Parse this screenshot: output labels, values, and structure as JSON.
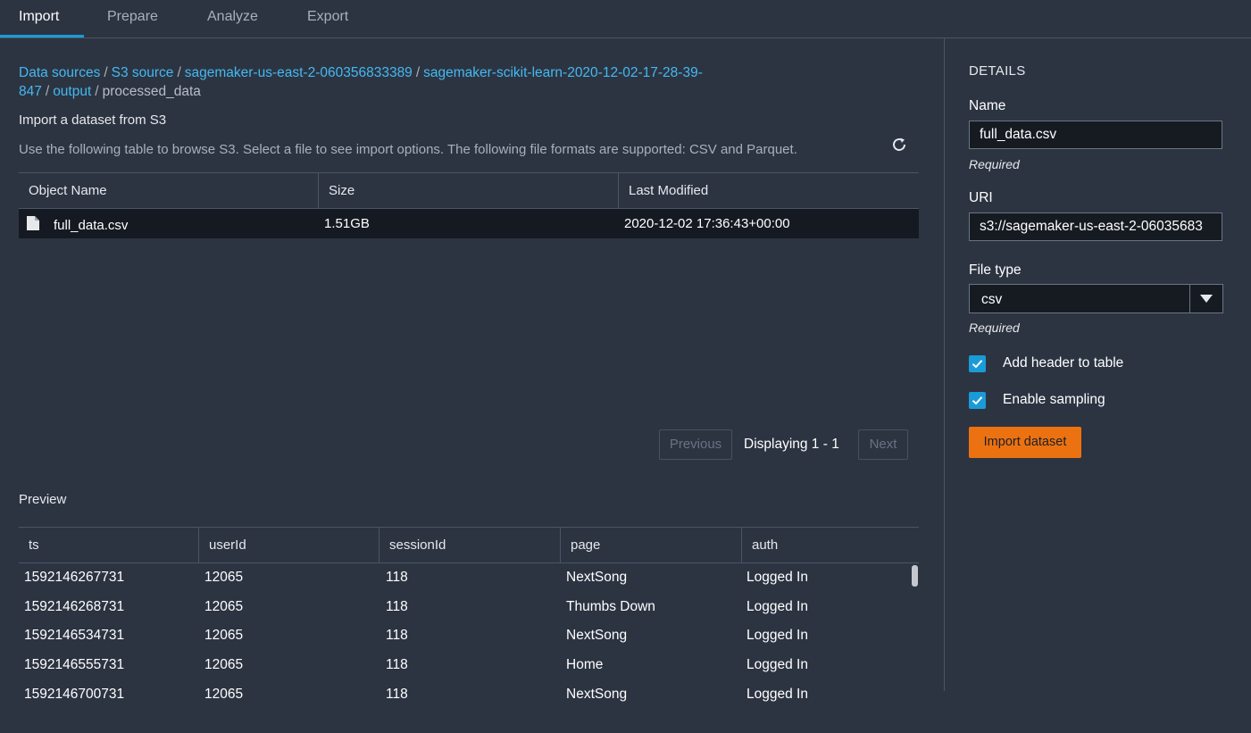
{
  "tabs": [
    {
      "label": "Import"
    },
    {
      "label": "Prepare"
    },
    {
      "label": "Analyze"
    },
    {
      "label": "Export"
    }
  ],
  "breadcrumb": {
    "items": [
      "Data sources",
      "S3 source",
      "sagemaker-us-east-2-060356833389",
      "sagemaker-scikit-learn-2020-12-02-17-28-39-",
      "847",
      "output"
    ],
    "current": "processed_data"
  },
  "import_section": {
    "title": "Import a dataset from S3",
    "description": "Use the following table to browse S3. Select a file to see import options. The following file formats are supported: CSV and Parquet."
  },
  "file_table": {
    "headers": [
      "Object Name",
      "Size",
      "Last Modified"
    ],
    "rows": [
      {
        "name": "full_data.csv",
        "size": "1.51GB",
        "modified": "2020-12-02 17:36:43+00:00"
      }
    ]
  },
  "pagination": {
    "previous": "Previous",
    "display": "Displaying 1 - 1",
    "next": "Next"
  },
  "preview": {
    "label": "Preview",
    "headers": [
      "ts",
      "userId",
      "sessionId",
      "page",
      "auth"
    ],
    "rows": [
      [
        "1592146267731",
        "12065",
        "118",
        "NextSong",
        "Logged In"
      ],
      [
        "1592146268731",
        "12065",
        "118",
        "Thumbs Down",
        "Logged In"
      ],
      [
        "1592146534731",
        "12065",
        "118",
        "NextSong",
        "Logged In"
      ],
      [
        "1592146555731",
        "12065",
        "118",
        "Home",
        "Logged In"
      ],
      [
        "1592146700731",
        "12065",
        "118",
        "NextSong",
        "Logged In"
      ]
    ]
  },
  "details": {
    "title": "DETAILS",
    "name_label": "Name",
    "name_value": "full_data.csv",
    "name_hint": "Required",
    "uri_label": "URI",
    "uri_value": "s3://sagemaker-us-east-2-06035683",
    "file_type_label": "File type",
    "file_type_value": "csv",
    "file_type_hint": "Required",
    "add_header_label": "Add header to table",
    "add_header_checked": true,
    "sampling_label": "Enable sampling",
    "sampling_checked": true,
    "import_button": "Import dataset"
  },
  "colors": {
    "background": "#2c3442",
    "accent_blue": "#1a9bd7",
    "link": "#44b9f0",
    "primary_button": "#ec7211"
  }
}
